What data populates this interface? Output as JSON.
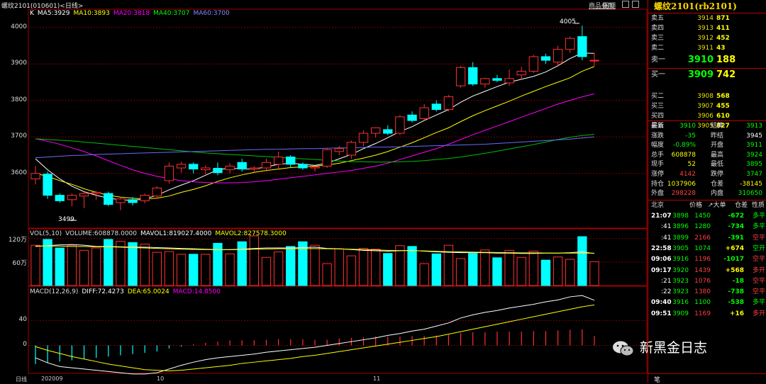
{
  "header": {
    "title": "螺纹2101(010601)<日线>",
    "links": [
      "商品叠加",
      "周期"
    ]
  },
  "ma_legend": [
    {
      "label": "K",
      "color": "#ffffff"
    },
    {
      "label": "MA5:3929",
      "color": "#ffffff"
    },
    {
      "label": "MA10:3893",
      "color": "#ffff00"
    },
    {
      "label": "MA20:3818",
      "color": "#ff00ff"
    },
    {
      "label": "MA40:3707",
      "color": "#00ff00"
    },
    {
      "label": "MA60:3700",
      "color": "#8888ff"
    }
  ],
  "vol_legend": [
    {
      "label": "VOL(5,10)",
      "color": "#dddddd"
    },
    {
      "label": "VOLUME:608878.0000",
      "color": "#dddddd"
    },
    {
      "label": "MAVOL1:819027.4000",
      "color": "#ffffff"
    },
    {
      "label": "MAVOL2:827578.3000",
      "color": "#ffff00"
    }
  ],
  "macd_legend": [
    {
      "label": "MACD(12,26,9)",
      "color": "#dddddd"
    },
    {
      "label": "DIFF:72.4273",
      "color": "#ffffff"
    },
    {
      "label": "DEA:65.0024",
      "color": "#ffff00"
    },
    {
      "label": "MACD:14.8500",
      "color": "#ff00ff"
    }
  ],
  "callouts": {
    "high": "4005",
    "low": "3499"
  },
  "x_labels": [
    "日线",
    "202009",
    "10",
    "11"
  ],
  "colors": {
    "up": "#ff3030",
    "down": "#00ffff",
    "grid": "#7a0000"
  },
  "chart_data": [
    {
      "type": "candlestick",
      "title": "螺纹2101(010601)<日线>",
      "ylim": [
        3450,
        4050
      ],
      "yticks": [
        3600,
        3700,
        3800,
        3900,
        4000
      ],
      "ohlc": [
        [
          3585,
          3620,
          3570,
          3600
        ],
        [
          3598,
          3605,
          3530,
          3540
        ],
        [
          3540,
          3545,
          3520,
          3525
        ],
        [
          3528,
          3545,
          3510,
          3540
        ],
        [
          3538,
          3550,
          3505,
          3545
        ],
        [
          3545,
          3552,
          3528,
          3548
        ],
        [
          3545,
          3550,
          3510,
          3515
        ],
        [
          3520,
          3535,
          3499,
          3530
        ],
        [
          3528,
          3535,
          3512,
          3520
        ],
        [
          3525,
          3545,
          3518,
          3540
        ],
        [
          3538,
          3565,
          3530,
          3560
        ],
        [
          3580,
          3630,
          3572,
          3620
        ],
        [
          3615,
          3632,
          3602,
          3625
        ],
        [
          3625,
          3630,
          3600,
          3612
        ],
        [
          3610,
          3622,
          3598,
          3615
        ],
        [
          3614,
          3630,
          3595,
          3602
        ],
        [
          3610,
          3628,
          3600,
          3620
        ],
        [
          3630,
          3640,
          3605,
          3612
        ],
        [
          3612,
          3620,
          3605,
          3615
        ],
        [
          3615,
          3640,
          3605,
          3630
        ],
        [
          3625,
          3660,
          3610,
          3645
        ],
        [
          3645,
          3650,
          3615,
          3625
        ],
        [
          3625,
          3630,
          3610,
          3615
        ],
        [
          3615,
          3620,
          3605,
          3618
        ],
        [
          3620,
          3670,
          3615,
          3665
        ],
        [
          3660,
          3675,
          3650,
          3668
        ],
        [
          3650,
          3690,
          3640,
          3685
        ],
        [
          3685,
          3718,
          3675,
          3710
        ],
        [
          3710,
          3725,
          3698,
          3725
        ],
        [
          3720,
          3732,
          3705,
          3710
        ],
        [
          3710,
          3760,
          3705,
          3755
        ],
        [
          3760,
          3770,
          3740,
          3745
        ],
        [
          3750,
          3790,
          3745,
          3780
        ],
        [
          3790,
          3800,
          3770,
          3775
        ],
        [
          3775,
          3815,
          3770,
          3810
        ],
        [
          3840,
          3895,
          3835,
          3890
        ],
        [
          3890,
          3905,
          3840,
          3845
        ],
        [
          3845,
          3862,
          3835,
          3860
        ],
        [
          3860,
          3870,
          3850,
          3855
        ],
        [
          3848,
          3885,
          3840,
          3860
        ],
        [
          3870,
          3892,
          3858,
          3880
        ],
        [
          3880,
          3925,
          3875,
          3920
        ],
        [
          3920,
          3928,
          3900,
          3910
        ],
        [
          3905,
          3950,
          3895,
          3940
        ],
        [
          3940,
          3975,
          3930,
          3970
        ],
        [
          3975,
          4005,
          3910,
          3920
        ],
        [
          3910,
          3930,
          3895,
          3910
        ]
      ],
      "ma": {
        "MA5": [
          3640,
          3610,
          3585,
          3565,
          3550,
          3540,
          3532,
          3528,
          3526,
          3530,
          3540,
          3555,
          3568,
          3580,
          3595,
          3610,
          3615,
          3612,
          3612,
          3618,
          3625,
          3628,
          3625,
          3622,
          3628,
          3640,
          3652,
          3668,
          3682,
          3698,
          3715,
          3728,
          3745,
          3760,
          3775,
          3795,
          3812,
          3825,
          3838,
          3850,
          3858,
          3866,
          3878,
          3895,
          3915,
          3930,
          3929
        ],
        "MA10": [
          3600,
          3592,
          3580,
          3570,
          3558,
          3548,
          3540,
          3535,
          3532,
          3530,
          3532,
          3538,
          3548,
          3556,
          3566,
          3578,
          3588,
          3596,
          3603,
          3608,
          3612,
          3616,
          3618,
          3620,
          3623,
          3628,
          3635,
          3642,
          3650,
          3660,
          3672,
          3684,
          3698,
          3712,
          3725,
          3742,
          3758,
          3772,
          3785,
          3798,
          3812,
          3825,
          3838,
          3850,
          3862,
          3880,
          3893
        ],
        "MA20": [
          3695,
          3688,
          3680,
          3670,
          3660,
          3648,
          3635,
          3622,
          3610,
          3600,
          3592,
          3586,
          3580,
          3577,
          3575,
          3574,
          3574,
          3575,
          3577,
          3580,
          3584,
          3588,
          3592,
          3596,
          3600,
          3604,
          3608,
          3614,
          3620,
          3628,
          3638,
          3648,
          3658,
          3668,
          3680,
          3693,
          3706,
          3718,
          3730,
          3742,
          3754,
          3766,
          3778,
          3790,
          3800,
          3810,
          3818
        ],
        "MA40": [
          3695,
          3693,
          3691,
          3689,
          3686,
          3683,
          3680,
          3677,
          3674,
          3671,
          3668,
          3665,
          3662,
          3659,
          3656,
          3654,
          3652,
          3650,
          3648,
          3646,
          3644,
          3642,
          3640,
          3638,
          3636,
          3634,
          3632,
          3632,
          3631,
          3631,
          3632,
          3633,
          3635,
          3638,
          3641,
          3645,
          3650,
          3655,
          3661,
          3667,
          3673,
          3679,
          3686,
          3693,
          3699,
          3704,
          3707
        ],
        "MA60": [
          3643,
          3645,
          3647,
          3649,
          3650,
          3652,
          3653,
          3654,
          3655,
          3656,
          3657,
          3658,
          3659,
          3660,
          3661,
          3662,
          3663,
          3664,
          3665,
          3666,
          3666,
          3667,
          3668,
          3668,
          3669,
          3670,
          3670,
          3671,
          3672,
          3672,
          3673,
          3674,
          3675,
          3676,
          3677,
          3678,
          3679,
          3680,
          3682,
          3684,
          3686,
          3688,
          3690,
          3692,
          3694,
          3697,
          3700
        ]
      }
    },
    {
      "type": "bar",
      "title": "VOL(5,10)",
      "ylim": [
        0,
        1450000
      ],
      "yticks": [
        600000,
        1200000
      ],
      "ytick_labels": [
        "60万",
        "120万"
      ],
      "values": [
        1030000,
        1180000,
        960000,
        1030000,
        900000,
        960000,
        1180000,
        1130000,
        1100000,
        1060000,
        850000,
        870000,
        800000,
        800000,
        800000,
        1080000,
        810000,
        1120000,
        1270000,
        720000,
        860000,
        1000000,
        1120000,
        1030000,
        560000,
        940000,
        760000,
        950000,
        930000,
        820000,
        1020000,
        1000000,
        560000,
        810000,
        1030000,
        690000,
        820000,
        910000,
        710000,
        900000,
        720000,
        880000,
        650000,
        730000,
        670000,
        1250000,
        608878
      ],
      "series": [
        {
          "name": "MAVOL1",
          "values": [
            1000000,
            1020000,
            1040000,
            1050000,
            1030000,
            1000000,
            1000000,
            990000,
            980000,
            980000,
            970000,
            960000,
            950000,
            940000,
            930000,
            920000,
            920000,
            930000,
            950000,
            960000,
            960000,
            960000,
            970000,
            980000,
            950000,
            940000,
            920000,
            900000,
            890000,
            880000,
            890000,
            900000,
            880000,
            860000,
            850000,
            840000,
            840000,
            840000,
            830000,
            830000,
            820000,
            820000,
            830000,
            830000,
            840000,
            860000,
            819027
          ]
        },
        {
          "name": "MAVOL2",
          "values": [
            1010000,
            1010000,
            1010000,
            1000000,
            1000000,
            990000,
            990000,
            980000,
            970000,
            960000,
            950000,
            940000,
            930000,
            925000,
            920000,
            915000,
            915000,
            920000,
            930000,
            935000,
            940000,
            940000,
            945000,
            945000,
            940000,
            935000,
            930000,
            920000,
            910000,
            900000,
            895000,
            890000,
            885000,
            875000,
            865000,
            860000,
            855000,
            850000,
            845000,
            840000,
            835000,
            835000,
            832000,
            830000,
            830000,
            830000,
            827578
          ]
        }
      ]
    },
    {
      "type": "bar",
      "title": "MACD(12,26,9)",
      "ylim": [
        -45,
        95
      ],
      "yticks": [
        0,
        40
      ],
      "macd": [
        -30,
        -28,
        -26,
        -24,
        -22,
        -20,
        -18,
        -16,
        -14,
        -12,
        -10,
        -5,
        -2,
        2,
        4,
        6,
        8,
        8,
        8,
        9,
        10,
        10,
        10,
        9,
        9,
        11,
        12,
        13,
        14,
        14,
        14,
        15,
        15,
        16,
        17,
        20,
        21,
        21,
        22,
        22,
        22,
        23,
        23,
        24,
        25,
        26,
        15
      ],
      "series": [
        {
          "name": "DIFF",
          "values": [
            -20,
            -28,
            -34,
            -36,
            -38,
            -40,
            -42,
            -44,
            -46,
            -46,
            -44,
            -38,
            -32,
            -27,
            -23,
            -20,
            -18,
            -16,
            -14,
            -11,
            -9,
            -7,
            -5,
            -3,
            0,
            3,
            6,
            9,
            12,
            16,
            19,
            23,
            26,
            31,
            36,
            44,
            49,
            53,
            56,
            60,
            63,
            66,
            70,
            73,
            78,
            80,
            72.4273
          ]
        },
        {
          "name": "DEA",
          "values": [
            -2,
            -8,
            -13,
            -18,
            -22,
            -26,
            -30,
            -33,
            -36,
            -39,
            -40,
            -41,
            -40,
            -38,
            -36,
            -34,
            -32,
            -29,
            -27,
            -25,
            -23,
            -21,
            -18,
            -16,
            -13,
            -10,
            -7,
            -4,
            -1,
            2,
            5,
            8,
            11,
            14,
            18,
            22,
            26,
            30,
            34,
            38,
            42,
            46,
            50,
            54,
            58,
            62,
            65.0024
          ]
        }
      ]
    }
  ],
  "order_book": {
    "sells": [
      {
        "label": "卖五",
        "price": "3914",
        "vol": "871"
      },
      {
        "label": "卖四",
        "price": "3913",
        "vol": "411"
      },
      {
        "label": "卖三",
        "price": "3912",
        "vol": "452"
      },
      {
        "label": "卖二",
        "price": "3911",
        "vol": "43"
      },
      {
        "label": "卖一",
        "price": "3910",
        "vol": "188"
      }
    ],
    "buys": [
      {
        "label": "买一",
        "price": "3909",
        "vol": "742"
      },
      {
        "label": "买二",
        "price": "3908",
        "vol": "568"
      },
      {
        "label": "买三",
        "price": "3907",
        "vol": "455"
      },
      {
        "label": "买四",
        "price": "3906",
        "vol": "610"
      },
      {
        "label": "买五",
        "price": "3905",
        "vol": "827"
      }
    ]
  },
  "panel_title": "螺纹2101(rb2101)",
  "stats": [
    {
      "l1": "最新",
      "v1": "3910",
      "c1": "#00ff00",
      "l2": "结算",
      "v2": "3913",
      "c2": "#00ff00"
    },
    {
      "l1": "涨跌",
      "v1": "-35",
      "c1": "#00ff00",
      "l2": "昨结",
      "v2": "3945",
      "c2": "#ffffff"
    },
    {
      "l1": "幅度",
      "v1": "-0.89%",
      "c1": "#00ff00",
      "l2": "开盘",
      "v2": "3911",
      "c2": "#00ff00"
    },
    {
      "l1": "总手",
      "v1": "608878",
      "c1": "#ffff00",
      "l2": "最高",
      "v2": "3924",
      "c2": "#00ff00"
    },
    {
      "l1": "现手",
      "v1": "52",
      "c1": "#ffff00",
      "l2": "最低",
      "v2": "3895",
      "c2": "#00ff00"
    },
    {
      "l1": "涨停",
      "v1": "4142",
      "c1": "#ff4040",
      "l2": "跌停",
      "v2": "3747",
      "c2": "#00ff00"
    },
    {
      "l1": "持仓",
      "v1": "1037906",
      "c1": "#ffff00",
      "l2": "仓差",
      "v2": "-38145",
      "c2": "#ffff00"
    },
    {
      "l1": "外盘",
      "v1": "298228",
      "c1": "#ff4040",
      "l2": "内盘",
      "v2": "310650",
      "c2": "#00ff00"
    }
  ],
  "tick_header": {
    "time": "北京",
    "price": "价格",
    "vol": "↗大单",
    "oi": "仓差",
    "nature": "性质"
  },
  "ticks": [
    {
      "time": "21:07",
      "price": "3898",
      "vol": "1450",
      "oi": "-672",
      "nature": "多平",
      "pc": "#00ff00",
      "vc": "#00ff00",
      "oc": "#00ff00",
      "nc": "#00ff00"
    },
    {
      "time": ":41",
      "price": "3896",
      "vol": "1280",
      "oi": "-734",
      "nature": "多平",
      "pc": "#00ff00",
      "vc": "#00ff00",
      "oc": "#00ff00",
      "nc": "#00ff00"
    },
    {
      "time": ":41",
      "price": "3899",
      "vol": "2166",
      "oi": "-391",
      "nature": "空平",
      "pc": "#00ff00",
      "vc": "#ff4040",
      "oc": "#00ff00",
      "nc": "#ff4040"
    },
    {
      "time": "22:58",
      "price": "3905",
      "vol": "1074",
      "oi": "+674",
      "nature": "空开",
      "pc": "#00ff00",
      "vc": "#00ff00",
      "oc": "#ffff00",
      "nc": "#00ff00"
    },
    {
      "time": "09:06",
      "price": "3916",
      "vol": "1196",
      "oi": "-1017",
      "nature": "空平",
      "pc": "#00ff00",
      "vc": "#ff4040",
      "oc": "#00ff00",
      "nc": "#ff4040"
    },
    {
      "time": "09:17",
      "price": "3920",
      "vol": "1439",
      "oi": "+568",
      "nature": "多开",
      "pc": "#00ff00",
      "vc": "#ff4040",
      "oc": "#ffff00",
      "nc": "#ff4040"
    },
    {
      "time": ":21",
      "price": "3923",
      "vol": "1076",
      "oi": "-18",
      "nature": "空平",
      "pc": "#00ff00",
      "vc": "#ff4040",
      "oc": "#00ff00",
      "nc": "#ff4040"
    },
    {
      "time": ":22",
      "price": "3923",
      "vol": "1380",
      "oi": "-738",
      "nature": "空平",
      "pc": "#00ff00",
      "vc": "#ff4040",
      "oc": "#00ff00",
      "nc": "#ff4040"
    },
    {
      "time": "09:40",
      "price": "3916",
      "vol": "1100",
      "oi": "-538",
      "nature": "多平",
      "pc": "#00ff00",
      "vc": "#00ff00",
      "oc": "#00ff00",
      "nc": "#00ff00"
    },
    {
      "time": "09:51",
      "price": "3909",
      "vol": "1169",
      "oi": "+16",
      "nature": "多开",
      "pc": "#00ff00",
      "vc": "#ff4040",
      "oc": "#ffff00",
      "nc": "#ff4040"
    }
  ],
  "tab_label": "笔",
  "watermark": {
    "text": "新黑金日志",
    "icon": "wechat-icon"
  }
}
